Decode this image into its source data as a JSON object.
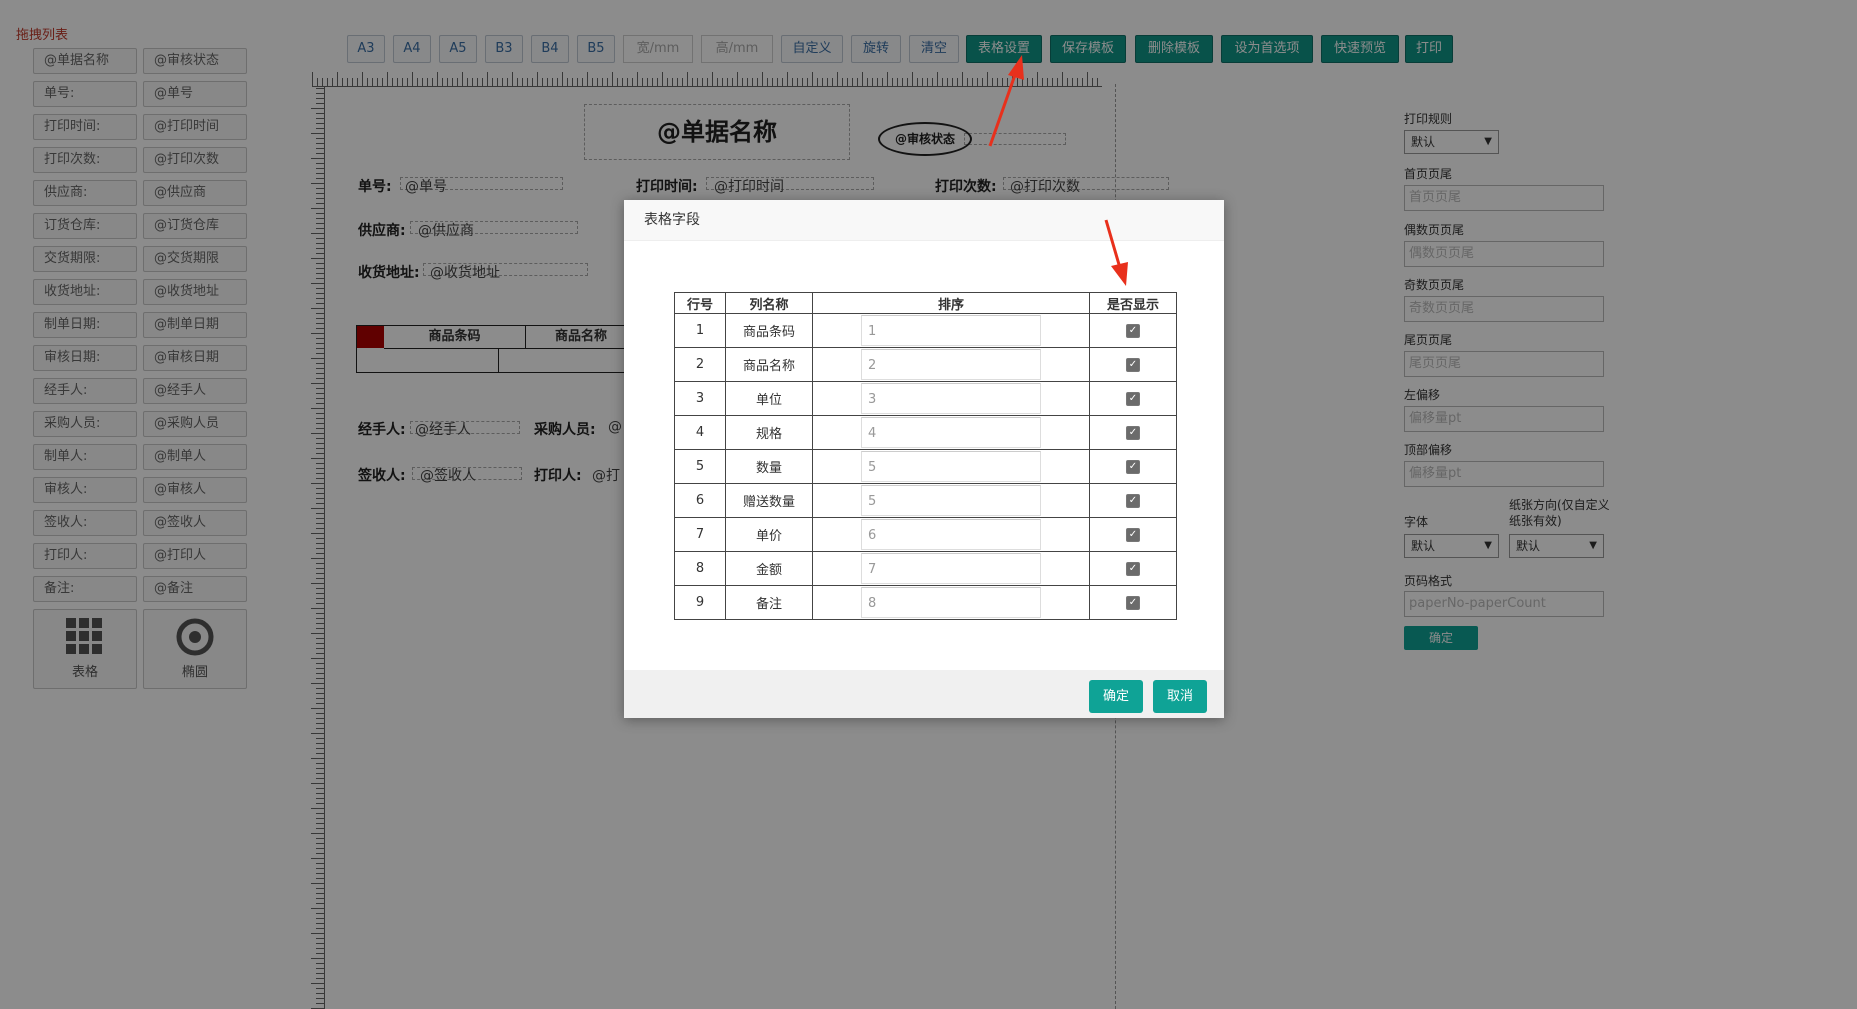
{
  "left_panel": {
    "title": "拖拽列表",
    "rows": [
      [
        "@单据名称",
        "@审核状态"
      ],
      [
        "单号:",
        "@单号"
      ],
      [
        "打印时间:",
        "@打印时间"
      ],
      [
        "打印次数:",
        "@打印次数"
      ],
      [
        "供应商:",
        "@供应商"
      ],
      [
        "订货仓库:",
        "@订货仓库"
      ],
      [
        "交货期限:",
        "@交货期限"
      ],
      [
        "收货地址:",
        "@收货地址"
      ],
      [
        "制单日期:",
        "@制单日期"
      ],
      [
        "审核日期:",
        "@审核日期"
      ],
      [
        "经手人:",
        "@经手人"
      ],
      [
        "采购人员:",
        "@采购人员"
      ],
      [
        "制单人:",
        "@制单人"
      ],
      [
        "审核人:",
        "@审核人"
      ],
      [
        "签收人:",
        "@签收人"
      ],
      [
        "打印人:",
        "@打印人"
      ],
      [
        "备注:",
        "@备注"
      ]
    ],
    "tiles": [
      {
        "label": "表格",
        "icon": "grid-icon"
      },
      {
        "label": "椭圆",
        "icon": "target-icon"
      }
    ]
  },
  "toolbar": {
    "paper_sizes": [
      "A3",
      "A4",
      "A5",
      "B3",
      "B4",
      "B5"
    ],
    "width_placeholder": "宽/mm",
    "height_placeholder": "高/mm",
    "plain_buttons": [
      "自定义",
      "旋转",
      "清空"
    ],
    "primary_buttons": [
      "表格设置",
      "保存模板",
      "删除模板",
      "设为首选项",
      "快速预览",
      "打印"
    ]
  },
  "canvas": {
    "doc_title": "@单据名称",
    "audit_status": "@审核状态",
    "fields": [
      {
        "label": "单号:",
        "value": "@单号"
      },
      {
        "label": "打印时间:",
        "value": "@打印时间"
      },
      {
        "label": "打印次数:",
        "value": "@打印次数"
      },
      {
        "label": "供应商:",
        "value": "@供应商"
      },
      {
        "label": "收货地址:",
        "value": "@收货地址"
      },
      {
        "label": "经手人:",
        "value": "@经手人"
      },
      {
        "label": "采购人员:",
        "value": "@"
      },
      {
        "label": "签收人:",
        "value": "@签收人"
      },
      {
        "label": "打印人:",
        "value": "@打"
      }
    ],
    "table_headers": [
      "商品条码",
      "商品名称"
    ]
  },
  "right_panel": {
    "print_rule_label": "打印规则",
    "print_rule_value": "默认",
    "first_footer_label": "首页页尾",
    "first_footer_placeholder": "首页页尾",
    "even_footer_label": "偶数页页尾",
    "even_footer_placeholder": "偶数页页尾",
    "odd_footer_label": "奇数页页尾",
    "odd_footer_placeholder": "奇数页页尾",
    "last_footer_label": "尾页页尾",
    "last_footer_placeholder": "尾页页尾",
    "left_offset_label": "左偏移",
    "left_offset_placeholder": "偏移量pt",
    "top_offset_label": "顶部偏移",
    "top_offset_placeholder": "偏移量pt",
    "font_label": "字体",
    "font_value": "默认",
    "orientation_label": "纸张方向(仅自定义纸张有效)",
    "orientation_value": "默认",
    "page_format_label": "页码格式",
    "page_format_placeholder": "paperNo-paperCount",
    "confirm_label": "确定"
  },
  "modal": {
    "title": "表格字段",
    "headers": [
      "行号",
      "列名称",
      "排序",
      "是否显示"
    ],
    "rows": [
      {
        "no": "1",
        "name": "商品条码",
        "sort": "1",
        "show": true
      },
      {
        "no": "2",
        "name": "商品名称",
        "sort": "2",
        "show": true
      },
      {
        "no": "3",
        "name": "单位",
        "sort": "3",
        "show": true
      },
      {
        "no": "4",
        "name": "规格",
        "sort": "4",
        "show": true
      },
      {
        "no": "5",
        "name": "数量",
        "sort": "5",
        "show": true
      },
      {
        "no": "6",
        "name": "赠送数量",
        "sort": "5",
        "show": true
      },
      {
        "no": "7",
        "name": "单价",
        "sort": "6",
        "show": true
      },
      {
        "no": "8",
        "name": "金额",
        "sort": "7",
        "show": true
      },
      {
        "no": "9",
        "name": "备注",
        "sort": "8",
        "show": true
      }
    ],
    "ok_label": "确定",
    "cancel_label": "取消"
  },
  "colors": {
    "primary": "#0f9588",
    "arrow": "#e8301c",
    "title_red": "#c0392b"
  }
}
